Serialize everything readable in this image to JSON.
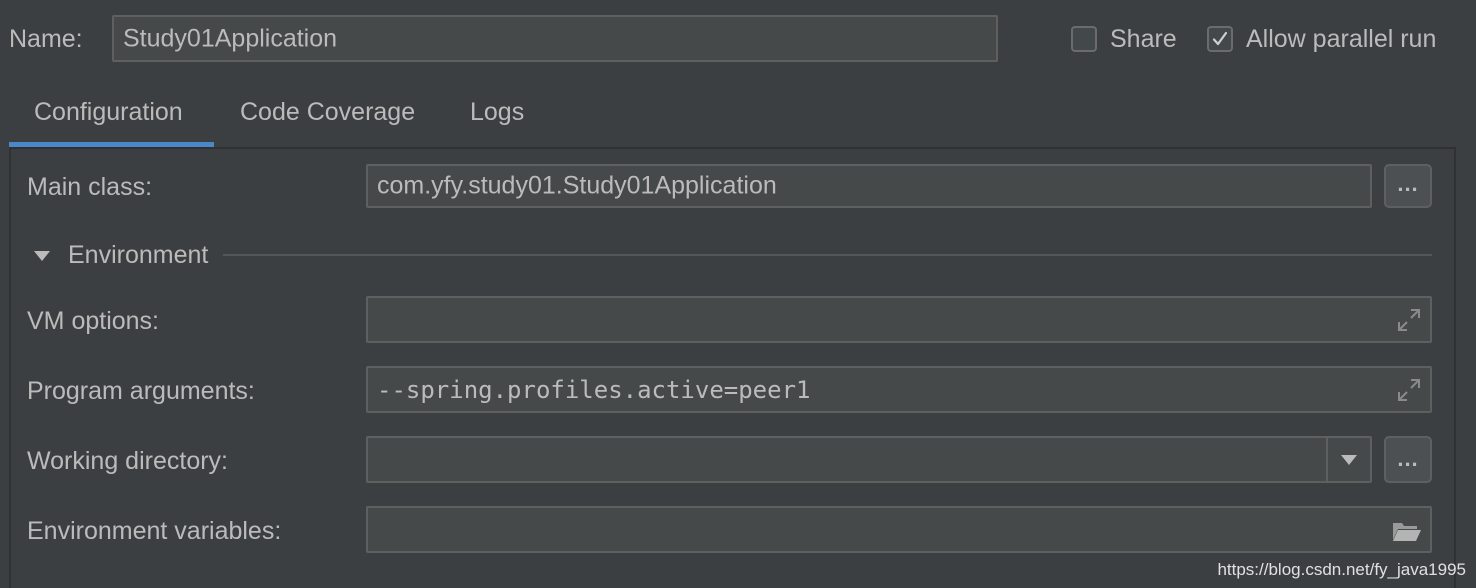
{
  "header": {
    "name_label": "Name:",
    "name_value": "Study01Application",
    "share_label": "Share",
    "share_checked": false,
    "parallel_label": "Allow parallel run",
    "parallel_checked": true
  },
  "tabs": [
    {
      "label": "Configuration",
      "active": true
    },
    {
      "label": "Code Coverage",
      "active": false
    },
    {
      "label": "Logs",
      "active": false
    }
  ],
  "config": {
    "main_class_label": "Main class:",
    "main_class_value": "com.yfy.study01.Study01Application",
    "browse_label": "...",
    "environment_section": "Environment",
    "vm_options_label": "VM options:",
    "vm_options_value": "",
    "program_args_label": "Program arguments:",
    "program_args_value": "--spring.profiles.active=peer1",
    "working_dir_label": "Working directory:",
    "working_dir_value": "",
    "env_vars_label": "Environment variables:",
    "env_vars_value": ""
  },
  "watermark": "https://blog.csdn.net/fy_java1995",
  "colors": {
    "background": "#3c3f41",
    "field_bg": "#45494a",
    "accent_tab": "#4a88c7",
    "text": "#bbbbbb"
  }
}
